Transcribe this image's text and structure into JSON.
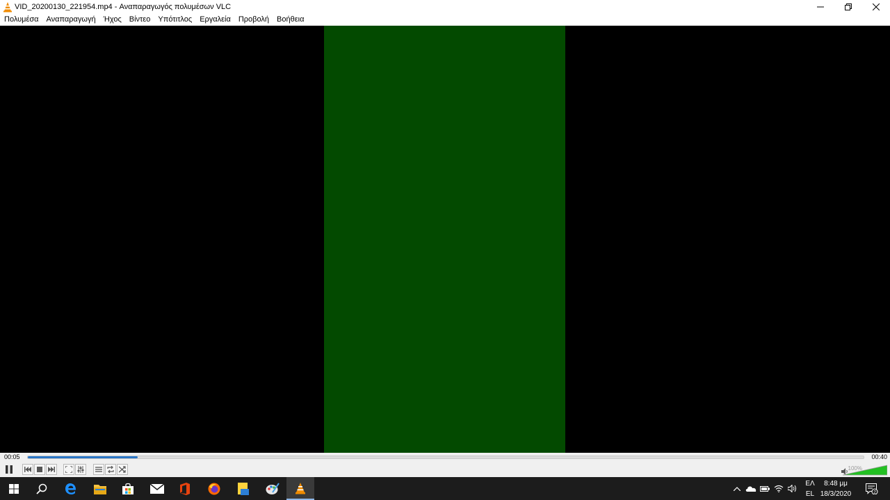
{
  "window": {
    "title": "VID_20200130_221954.mp4 - Αναπαραγωγός πολυμέσων VLC",
    "controls": [
      "minimize-icon",
      "restore-icon",
      "close-icon"
    ]
  },
  "menu": [
    "Πολυμέσα",
    "Αναπαραγωγή",
    "Ήχος",
    "Βίντεο",
    "Υπότιτλος",
    "Εργαλεία",
    "Προβολή",
    "Βοήθεια"
  ],
  "video": {
    "background": "#000000",
    "frame_color": "#034a00"
  },
  "playback": {
    "elapsed": "00:05",
    "total": "00:40",
    "progress": 0.1317
  },
  "controls": {
    "buttons": [
      "pause-icon",
      "previous-icon",
      "stop-icon",
      "next-icon",
      "fullscreen-icon",
      "extended-settings-icon",
      "playlist-icon",
      "loop-icon",
      "shuffle-icon"
    ],
    "volume_label": "100%",
    "volume_level": 1.0
  },
  "taskbar": {
    "apps": [
      "windows-start-icon",
      "search-icon",
      "edge-icon",
      "file-explorer-icon",
      "store-icon",
      "mail-icon",
      "office-icon",
      "firefox-icon",
      "sticky-notes-icon",
      "paint-icon",
      "vlc-icon"
    ],
    "active_app": "vlc-icon",
    "tray": [
      "chevron-up-icon",
      "onedrive-icon",
      "battery-icon",
      "wifi-icon",
      "speaker-icon"
    ],
    "lang_top": "ΕΛ",
    "lang_bottom": "EL",
    "time": "8:48 μμ",
    "date": "18/3/2020",
    "notifications": "2"
  },
  "colors": {
    "accent": "#2a76c6",
    "vlc_orange": "#f08c00",
    "volume_green": "#22c022"
  }
}
